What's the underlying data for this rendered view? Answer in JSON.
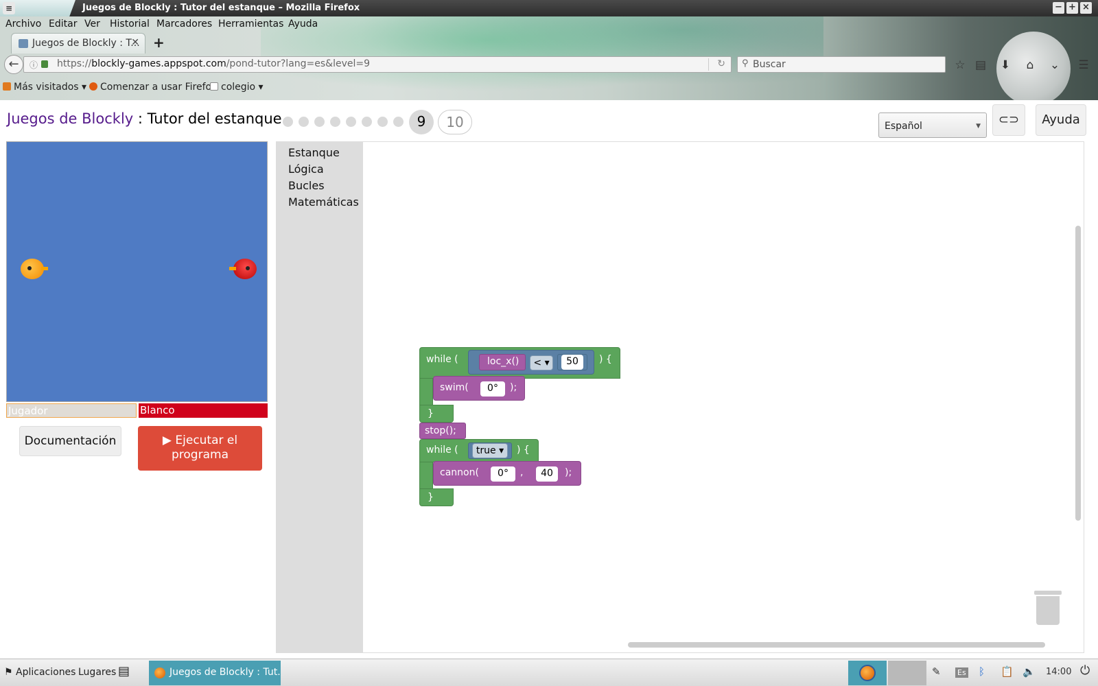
{
  "window": {
    "title": "Juegos de Blockly : Tutor del estanque – Mozilla Firefox"
  },
  "menubar": [
    "Archivo",
    "Editar",
    "Ver",
    "Historial",
    "Marcadores",
    "Herramientas",
    "Ayuda"
  ],
  "tab": {
    "label": "Juegos de Blockly : T..."
  },
  "urlbar": {
    "scheme": "https://",
    "host": "blockly-games.appspot.com",
    "path": "/pond-tutor?lang=es&level=9"
  },
  "search": {
    "placeholder": "Buscar"
  },
  "bookmarks": [
    "Más visitados",
    "Comenzar a usar Firefox",
    "colegio"
  ],
  "page": {
    "title_link": "Juegos de Blockly",
    "title_sep": " : ",
    "title_rest": "Tutor del estanque",
    "levels": {
      "completed_count": 8,
      "current": "9",
      "next": "10"
    },
    "language": "Español",
    "help_label": "Ayuda",
    "player_label": "Jugador",
    "target_label": "Blanco",
    "doc_button": "Documentación",
    "run_button": "Ejecutar el programa"
  },
  "toolbox": [
    "Estanque",
    "Lógica",
    "Bucles",
    "Matemáticas"
  ],
  "blocks": {
    "while1": {
      "kw": "while (",
      "close": ") {",
      "cond_fn": "loc_x()",
      "op": "<",
      "value": "50"
    },
    "swim": {
      "fn": "swim(",
      "arg": "0°",
      "end": ");"
    },
    "brace1": "}",
    "stop": "stop();",
    "while2": {
      "kw": "while (",
      "close": ") {",
      "cond": "true"
    },
    "cannon": {
      "fn": "cannon(",
      "arg1": "0°",
      "sep": ",",
      "arg2": "40",
      "end": ");"
    },
    "brace2": "}"
  },
  "taskbar": {
    "apps": "Aplicaciones",
    "places": "Lugares",
    "task": "Juegos de Blockly : Tut...",
    "keyboard": "Es",
    "clock": "14:00"
  }
}
